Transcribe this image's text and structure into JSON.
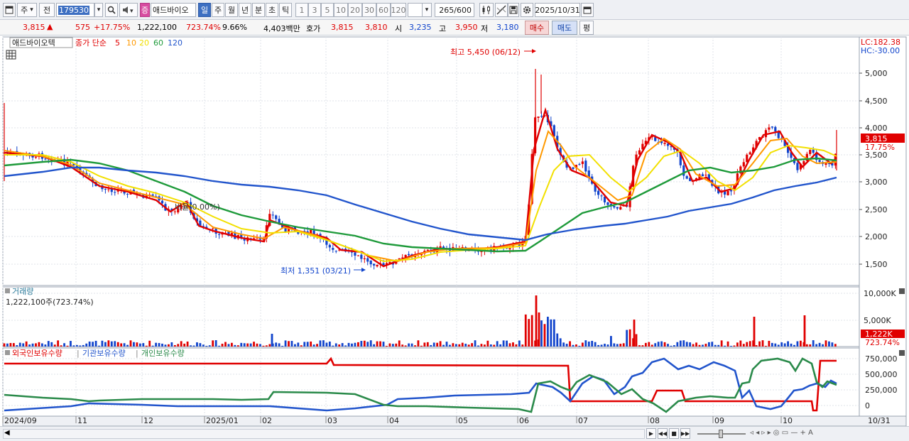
{
  "toolbar": {
    "period_label": "주",
    "all_label": "전",
    "stock_code": "179530",
    "type_badge": "증",
    "stock_name": "애드바이오",
    "period_tabs": [
      "일",
      "주",
      "월",
      "년",
      "분",
      "초",
      "틱"
    ],
    "active_tab": "일",
    "interval_buttons": [
      "1",
      "3",
      "5",
      "10",
      "20",
      "30",
      "60",
      "120"
    ],
    "count_value": "265",
    "count_total": "/600",
    "date_value": "2025/10/31"
  },
  "ticker": {
    "price": "3,815",
    "up_arrow": "▲",
    "change": "575",
    "change_pct": "+17.75%",
    "volume": "1,222,100",
    "volume_pct": "723.74%",
    "turnover_pct": "9.66%",
    "amount": "4,403백만",
    "quote_label": "호가",
    "ask": "3,815",
    "bid": "3,810",
    "open_label": "시",
    "open": "3,235",
    "high_label": "고",
    "high": "3,950",
    "low_label": "저",
    "low": "3,180",
    "buy_label": "매수",
    "sell_label": "매도",
    "avg_label": "평"
  },
  "price_panel": {
    "stock_name": "애드바이오텍",
    "ma_title": "종가 단순",
    "ma_periods": [
      "5",
      "10",
      "20",
      "60",
      "120"
    ],
    "ma_colors": [
      "#e00000",
      "#ff9900",
      "#f2e000",
      "#1e9a3a",
      "#2255cc"
    ],
    "lc_label": "LC:182.38",
    "hc_label": "HC:-30.00",
    "high_annotation": "최고 5,450 (06/12)",
    "low_annotation": "최저 1,351 (03/21)",
    "ratio_label": "비율(0.00%)",
    "current_price": "3,815",
    "current_pct": "17.75%",
    "y_ticks": [
      "5,000",
      "4,500",
      "4,000",
      "3,500",
      "3,000",
      "2,500",
      "2,000",
      "1,500"
    ]
  },
  "volume_panel": {
    "title": "거래량",
    "value": "1,222,100주(723.74%)",
    "y_ticks": [
      "10,000K",
      "5,000K"
    ],
    "current_value": "1,222K",
    "current_pct": "723.74%"
  },
  "holding_panel": {
    "series": [
      {
        "name": "외국인보유수량",
        "color": "#e00000"
      },
      {
        "name": "기관보유수량",
        "color": "#2255cc"
      },
      {
        "name": "개인보유수량",
        "color": "#2a8a4a"
      }
    ],
    "y_ticks": [
      "750,000",
      "500,000",
      "250,000",
      "0"
    ]
  },
  "x_axis": {
    "labels": [
      "2024/09",
      "11",
      "12",
      "2025/01",
      "02",
      "03",
      "04",
      "05",
      "06",
      "07",
      "08",
      "09",
      "10"
    ],
    "end_label": "10/31"
  },
  "colors": {
    "up": "#e00000",
    "down": "#1144cc",
    "grid": "#dfe3ea"
  }
}
